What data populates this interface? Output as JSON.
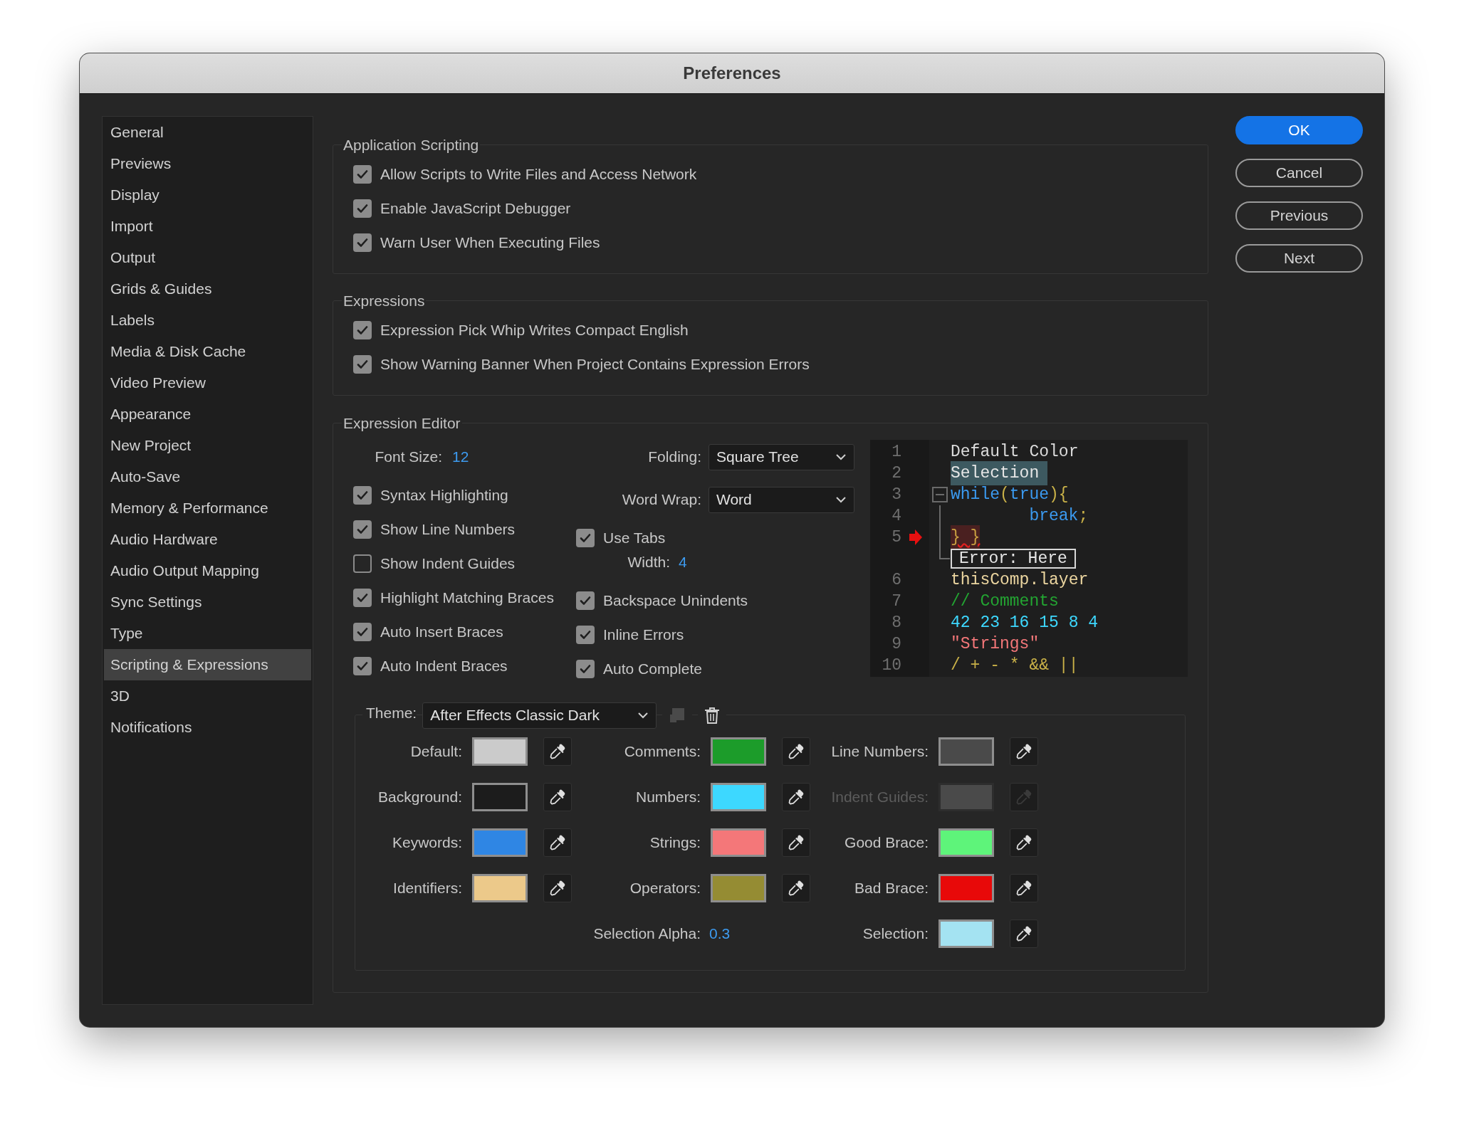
{
  "window": {
    "title": "Preferences"
  },
  "sidebar": {
    "items": [
      {
        "label": "General",
        "selected": false
      },
      {
        "label": "Previews",
        "selected": false
      },
      {
        "label": "Display",
        "selected": false
      },
      {
        "label": "Import",
        "selected": false
      },
      {
        "label": "Output",
        "selected": false
      },
      {
        "label": "Grids & Guides",
        "selected": false
      },
      {
        "label": "Labels",
        "selected": false
      },
      {
        "label": "Media & Disk Cache",
        "selected": false
      },
      {
        "label": "Video Preview",
        "selected": false
      },
      {
        "label": "Appearance",
        "selected": false
      },
      {
        "label": "New Project",
        "selected": false
      },
      {
        "label": "Auto-Save",
        "selected": false
      },
      {
        "label": "Memory & Performance",
        "selected": false
      },
      {
        "label": "Audio Hardware",
        "selected": false
      },
      {
        "label": "Audio Output Mapping",
        "selected": false
      },
      {
        "label": "Sync Settings",
        "selected": false
      },
      {
        "label": "Type",
        "selected": false
      },
      {
        "label": "Scripting & Expressions",
        "selected": true
      },
      {
        "label": "3D",
        "selected": false
      },
      {
        "label": "Notifications",
        "selected": false
      }
    ]
  },
  "buttons": [
    {
      "label": "OK",
      "kind": "primary"
    },
    {
      "label": "Cancel",
      "kind": "outline"
    },
    {
      "label": "Previous",
      "kind": "outline"
    },
    {
      "label": "Next",
      "kind": "outline"
    }
  ],
  "sections": [
    {
      "title": "Application Scripting",
      "options": [
        {
          "label": "Allow Scripts to Write Files and Access Network",
          "checked": true
        },
        {
          "label": "Enable JavaScript Debugger",
          "checked": true
        },
        {
          "label": "Warn User When Executing Files",
          "checked": true
        }
      ]
    },
    {
      "title": "Expressions",
      "options": [
        {
          "label": "Expression Pick Whip Writes Compact English",
          "checked": true
        },
        {
          "label": "Show Warning Banner When Project Contains Expression Errors",
          "checked": true
        }
      ]
    }
  ],
  "expression_editor": {
    "title": "Expression Editor",
    "font_size": {
      "label": "Font Size:",
      "value": "12"
    },
    "options_left": [
      {
        "label": "Syntax Highlighting",
        "checked": true
      },
      {
        "label": "Show Line Numbers",
        "checked": true
      },
      {
        "label": "Show Indent Guides",
        "checked": false
      },
      {
        "label": "Highlight Matching Braces",
        "checked": true
      },
      {
        "label": "Auto Insert Braces",
        "checked": true
      },
      {
        "label": "Auto Indent Braces",
        "checked": true
      }
    ],
    "folding": {
      "label": "Folding:",
      "value": "Square Tree"
    },
    "word_wrap": {
      "label": "Word Wrap:",
      "value": "Word"
    },
    "use_tabs": {
      "label": "Use Tabs",
      "checked": true
    },
    "tab_width": {
      "label": "Width:",
      "value": "4"
    },
    "options_right": [
      {
        "label": "Backspace Unindents",
        "checked": true
      },
      {
        "label": "Inline Errors",
        "checked": true
      },
      {
        "label": "Auto Complete",
        "checked": true
      }
    ],
    "preview": {
      "lines": [
        {
          "kind": "code",
          "number": "1",
          "fold": false,
          "indented": false,
          "error_marker": false,
          "segments": [
            {
              "text": "Default Color",
              "kind": "default"
            }
          ]
        },
        {
          "kind": "code",
          "number": "2",
          "fold": false,
          "indented": false,
          "error_marker": false,
          "segments": [
            {
              "text": "Selection",
              "kind": "selection"
            }
          ]
        },
        {
          "kind": "code",
          "number": "3",
          "fold": true,
          "indented": false,
          "error_marker": false,
          "segments": [
            {
              "text": "while",
              "kind": "keyword"
            },
            {
              "text": "(",
              "kind": "operator"
            },
            {
              "text": "true",
              "kind": "keyword"
            },
            {
              "text": "){",
              "kind": "operator"
            }
          ]
        },
        {
          "kind": "code",
          "number": "4",
          "fold": false,
          "indented": true,
          "error_marker": false,
          "segments": [
            {
              "text": "break",
              "kind": "keyword"
            },
            {
              "text": ";",
              "kind": "operator"
            }
          ]
        },
        {
          "kind": "code",
          "number": "5",
          "fold": false,
          "indented": false,
          "error_marker": true,
          "segments": [
            {
              "text": "} }",
              "kind": "bad_brace"
            }
          ]
        },
        {
          "kind": "error",
          "text": "Error: Here"
        },
        {
          "kind": "code",
          "number": "6",
          "fold": false,
          "indented": false,
          "error_marker": false,
          "segments": [
            {
              "text": "thisComp.layer",
              "kind": "identifier"
            }
          ]
        },
        {
          "kind": "code",
          "number": "7",
          "fold": false,
          "indented": false,
          "error_marker": false,
          "segments": [
            {
              "text": "// Comments",
              "kind": "comment"
            }
          ]
        },
        {
          "kind": "code",
          "number": "8",
          "fold": false,
          "indented": false,
          "error_marker": false,
          "segments": [
            {
              "text": "42 23 16 15 8 4",
              "kind": "number"
            }
          ]
        },
        {
          "kind": "code",
          "number": "9",
          "fold": false,
          "indented": false,
          "error_marker": false,
          "segments": [
            {
              "text": "\"Strings\"",
              "kind": "string"
            }
          ]
        },
        {
          "kind": "code",
          "number": "10",
          "fold": false,
          "indented": false,
          "error_marker": false,
          "segments": [
            {
              "text": "/ + - * && ||",
              "kind": "operator"
            }
          ]
        }
      ]
    },
    "theme": {
      "label": "Theme:",
      "value": "After Effects Classic Dark",
      "columns": [
        [
          {
            "label": "Default:",
            "kind": "swatch",
            "color": "#cbcbcb",
            "disabled": false
          },
          {
            "label": "Background:",
            "kind": "swatch",
            "color": "#1c1c1c",
            "disabled": false
          },
          {
            "label": "Keywords:",
            "kind": "swatch",
            "color": "#2f86e4",
            "disabled": false
          },
          {
            "label": "Identifiers:",
            "kind": "swatch",
            "color": "#ecc98a",
            "disabled": false
          }
        ],
        [
          {
            "label": "Comments:",
            "kind": "swatch",
            "color": "#1c9c2a",
            "disabled": false
          },
          {
            "label": "Numbers:",
            "kind": "swatch",
            "color": "#3dd8ff",
            "disabled": false
          },
          {
            "label": "Strings:",
            "kind": "swatch",
            "color": "#f47779",
            "disabled": false
          },
          {
            "label": "Operators:",
            "kind": "swatch",
            "color": "#958c33",
            "disabled": false
          },
          {
            "label": "Selection Alpha:",
            "kind": "value",
            "value": "0.3"
          }
        ],
        [
          {
            "label": "Line Numbers:",
            "kind": "swatch",
            "color": "#4a4a4a",
            "disabled": false
          },
          {
            "label": "Indent Guides:",
            "kind": "swatch",
            "color": "#4a4a4a",
            "disabled": true
          },
          {
            "label": "Good Brace:",
            "kind": "swatch",
            "color": "#5ef47a",
            "disabled": false
          },
          {
            "label": "Bad Brace:",
            "kind": "swatch",
            "color": "#e80909",
            "disabled": false
          },
          {
            "label": "Selection:",
            "kind": "swatch",
            "color": "#a4e3f2",
            "disabled": false
          }
        ]
      ]
    }
  }
}
